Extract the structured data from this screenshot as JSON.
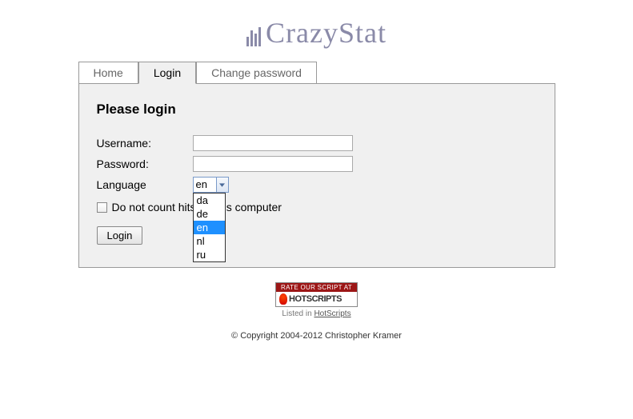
{
  "logo": {
    "text": "CrazyStat"
  },
  "tabs": {
    "home": "Home",
    "login": "Login",
    "change_password": "Change password"
  },
  "form": {
    "heading": "Please login",
    "username_label": "Username:",
    "password_label": "Password:",
    "language_label": "Language",
    "username_value": "",
    "password_value": "",
    "selected_lang": "en",
    "lang_options": [
      "da",
      "de",
      "en",
      "nl",
      "ru"
    ],
    "checkbox_label": "Do not count hits on this computer",
    "submit_label": "Login"
  },
  "footer": {
    "rate_label": "RATE OUR SCRIPT AT",
    "hotscripts_brand": "HOTSCRIPTS",
    "listed_prefix": "Listed in ",
    "listed_link": "HotScripts",
    "copyright": "© Copyright 2004-2012 Christopher Kramer"
  }
}
